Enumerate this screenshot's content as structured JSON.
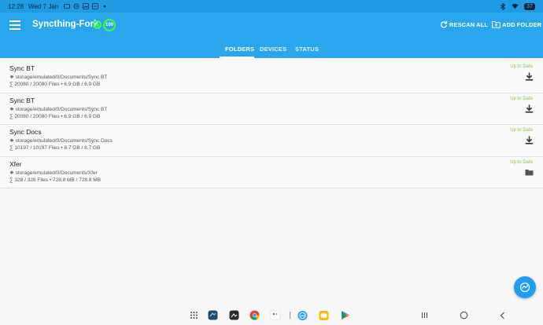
{
  "statusbar": {
    "time": "12:28",
    "date": "Wed 7 Jan",
    "battery": "37"
  },
  "appbar": {
    "title": "Syncthing-Fork",
    "progress": "100",
    "rescan_label": "RESCAN ALL",
    "add_folder_label": "ADD FOLDER"
  },
  "tabs": [
    {
      "label": "FOLDERS",
      "active": true
    },
    {
      "label": "DEVICES",
      "active": false
    },
    {
      "label": "STATUS",
      "active": false
    }
  ],
  "folders": [
    {
      "name": "Sync BT",
      "path": "❖ storage/emulated/0/Documents/Sync BT",
      "stats": "∑ 20080 / 20080 Files • 6.9 GB / 6.9 GB",
      "state": "Up to Date",
      "icon": "download-icon"
    },
    {
      "name": "Sync BT",
      "path": "❖ storage/emulated/0/Documents/Sync BT",
      "stats": "∑ 20080 / 20080 Files • 6.9 GB / 6.9 GB",
      "state": "Up to Date",
      "icon": "download-icon"
    },
    {
      "name": "Sync Docs",
      "path": "❖ storage/emulated/0/Documents/Sync Docs",
      "stats": "∑ 10197 / 10197 Files • 8.7 GB / 8.7 GB",
      "state": "Up to Date",
      "icon": "download-icon"
    },
    {
      "name": "Xfer",
      "path": "❖ storage/emulated/0/Documents/Xfer",
      "stats": "∑ 328 / 328 Files • 728.8 MB / 728.8 MB",
      "state": "Up to Date",
      "icon": "folder-icon"
    }
  ],
  "colors": {
    "statusbar": "#1f9be3",
    "appbar": "#2aa6ee",
    "up_to_date": "#8bc34a",
    "fab": "#1e9ef0",
    "connected": "#3bff3b"
  },
  "dock": [
    "apps-grid-icon",
    "bluetooth-app-icon",
    "photo-editor-icon",
    "chrome-icon",
    "calendar-icon",
    "syncthing-icon",
    "notes-icon",
    "play-store-icon"
  ],
  "navbar": [
    "recents-icon",
    "home-icon",
    "back-icon"
  ]
}
